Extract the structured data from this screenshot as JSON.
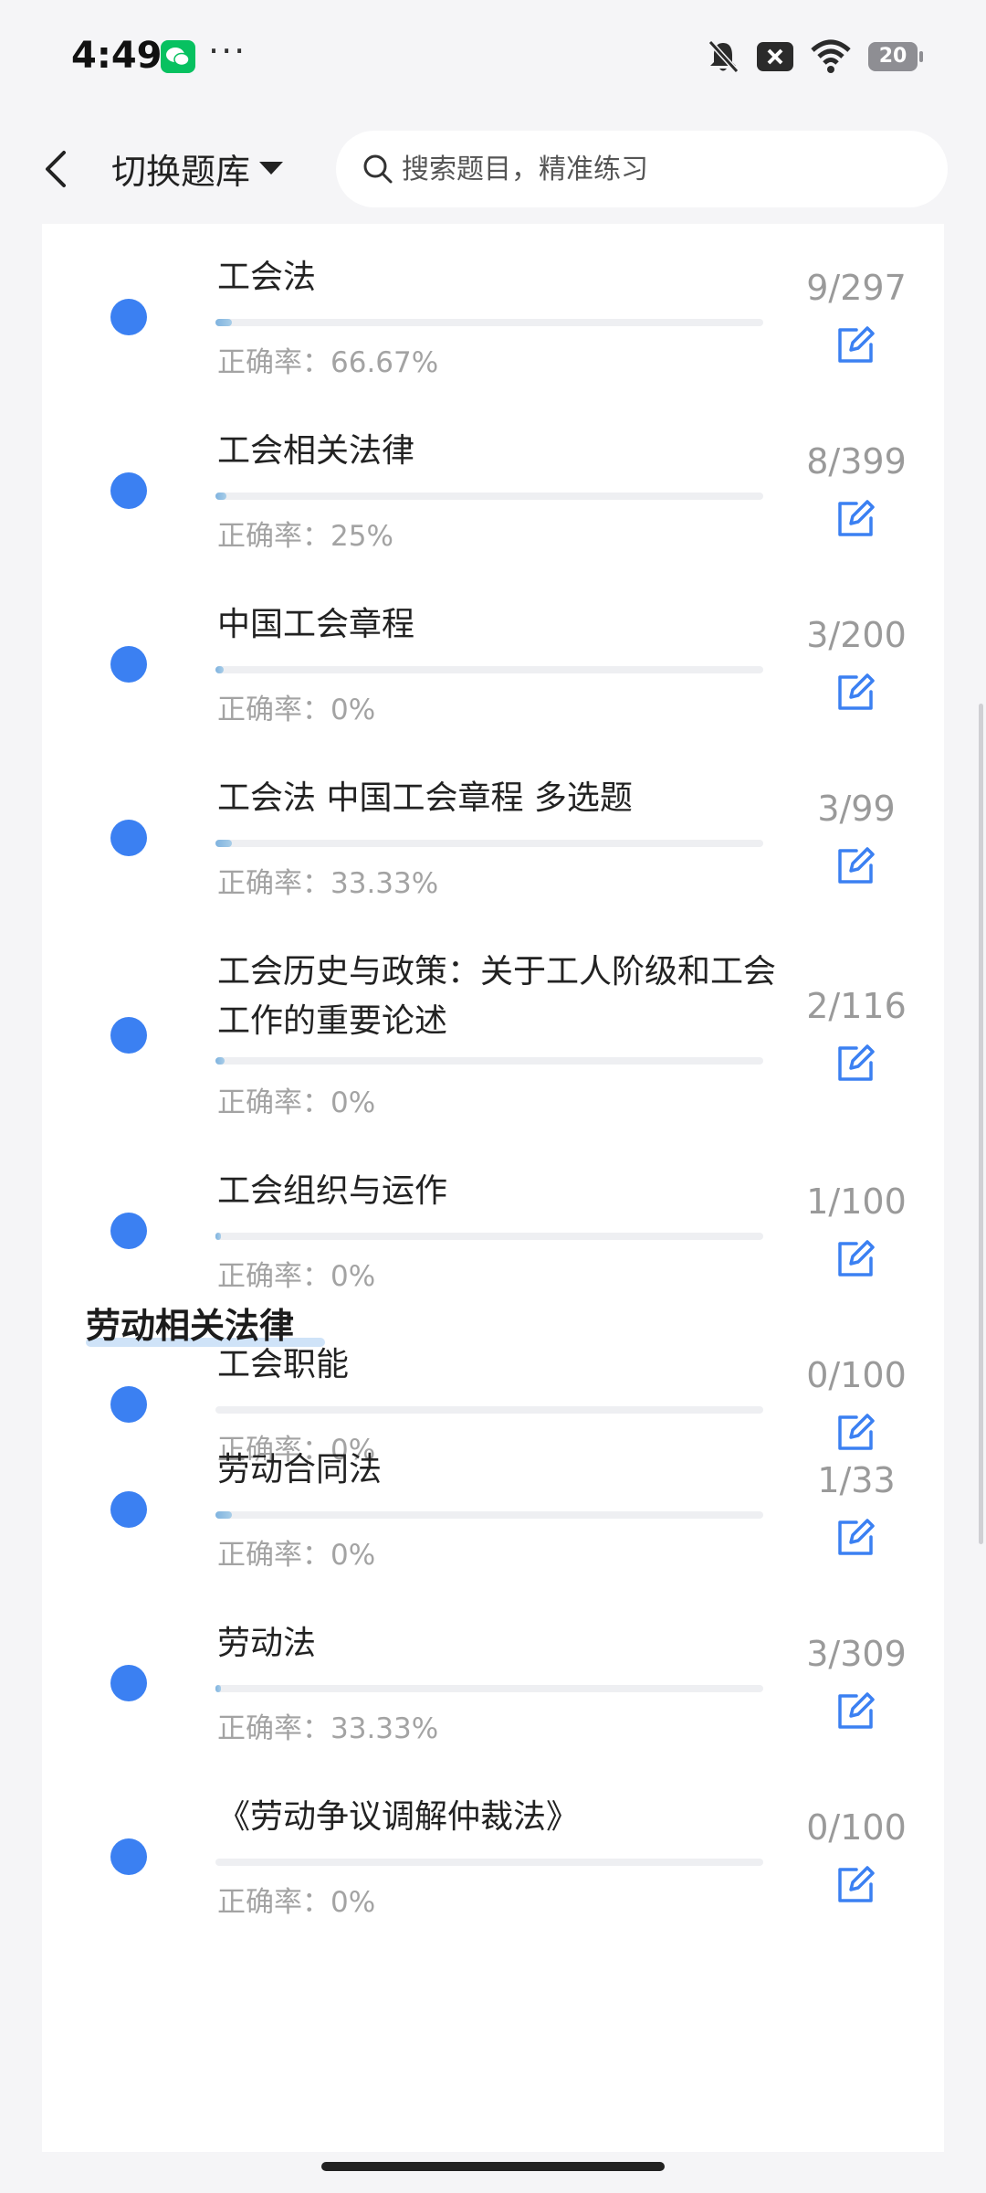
{
  "status": {
    "time": "4:49",
    "more": "···",
    "battery": "20"
  },
  "header": {
    "switch_label": "切换题库",
    "search_placeholder": "搜索题目，精准练习"
  },
  "colors": {
    "accent": "#3b80f2",
    "progress": "#7fb3df",
    "muted": "#a3a3a3"
  },
  "group1": {
    "items": [
      {
        "title": "工会法",
        "rate": "正确率：66.67%",
        "count": "9/297",
        "progress": 0.03
      },
      {
        "title": "工会相关法律",
        "rate": "正确率：25%",
        "count": "8/399",
        "progress": 0.02
      },
      {
        "title": "中国工会章程",
        "rate": "正确率：0%",
        "count": "3/200",
        "progress": 0.015
      },
      {
        "title": "工会法 中国工会章程 多选题",
        "rate": "正确率：33.33%",
        "count": "3/99",
        "progress": 0.03
      },
      {
        "title": "工会历史与政策：关于工人阶级和工会工作的重要论述",
        "rate": "正确率：0%",
        "count": "2/116",
        "progress": 0.017
      },
      {
        "title": "工会组织与运作",
        "rate": "正确率：0%",
        "count": "1/100",
        "progress": 0.01
      },
      {
        "title": "工会职能",
        "rate": "正确率：0%",
        "count": "0/100",
        "progress": 0.0
      }
    ]
  },
  "group2": {
    "title": "劳动相关法律",
    "items": [
      {
        "title": "劳动合同法",
        "rate": "正确率：0%",
        "count": "1/33",
        "progress": 0.03
      },
      {
        "title": "劳动法",
        "rate": "正确率：33.33%",
        "count": "3/309",
        "progress": 0.01
      },
      {
        "title": "《劳动争议调解仲裁法》",
        "rate": "正确率：0%",
        "count": "0/100",
        "progress": 0.0
      }
    ]
  }
}
